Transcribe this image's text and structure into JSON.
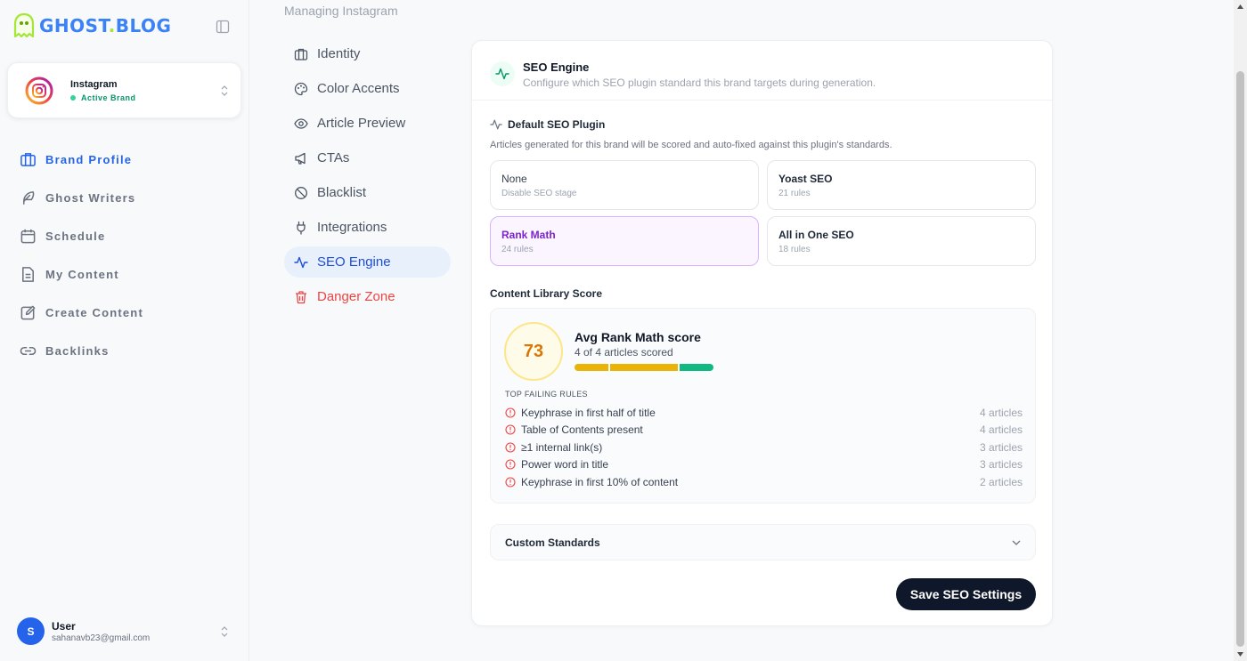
{
  "app": {
    "logo_text": "GHOST",
    "logo_dot": ".",
    "logo_text2": "BLOG"
  },
  "brand": {
    "name": "Instagram",
    "status": "Active Brand"
  },
  "sidebar": {
    "items": [
      {
        "label": "Brand Profile",
        "icon": "briefcase-icon",
        "active": true
      },
      {
        "label": "Ghost Writers",
        "icon": "feather-icon"
      },
      {
        "label": "Schedule",
        "icon": "calendar-icon"
      },
      {
        "label": "My Content",
        "icon": "file-text-icon"
      },
      {
        "label": "Create Content",
        "icon": "edit-icon"
      },
      {
        "label": "Backlinks",
        "icon": "link-icon"
      }
    ]
  },
  "user": {
    "initial": "S",
    "name": "User",
    "email": "sahanavb23@gmail.com"
  },
  "settings": {
    "managing": "Managing Instagram",
    "items": [
      {
        "label": "Identity",
        "icon": "briefcase-icon"
      },
      {
        "label": "Color Accents",
        "icon": "palette-icon"
      },
      {
        "label": "Article Preview",
        "icon": "eye-icon"
      },
      {
        "label": "CTAs",
        "icon": "megaphone-icon"
      },
      {
        "label": "Blacklist",
        "icon": "ban-icon"
      },
      {
        "label": "Integrations",
        "icon": "plug-icon"
      },
      {
        "label": "SEO Engine",
        "icon": "activity-icon",
        "active": true
      },
      {
        "label": "Danger Zone",
        "icon": "trash-icon",
        "danger": true
      }
    ]
  },
  "seo": {
    "title": "SEO Engine",
    "subtitle": "Configure which SEO plugin standard this brand targets during generation.",
    "default_plugin_label": "Default SEO Plugin",
    "default_plugin_desc": "Articles generated for this brand will be scored and auto-fixed against this plugin's standards.",
    "plugins": [
      {
        "name": "None",
        "sub": "Disable SEO stage"
      },
      {
        "name": "Yoast SEO",
        "sub": "21 rules"
      },
      {
        "name": "Rank Math",
        "sub": "24 rules",
        "selected": true
      },
      {
        "name": "All in One SEO",
        "sub": "18 rules"
      }
    ],
    "library_label": "Content Library Score",
    "score": {
      "value": "73",
      "title": "Avg Rank Math score",
      "sub": "4 of 4 articles scored",
      "bar_segments": [
        {
          "share": 0.25,
          "color": "#eab308"
        },
        {
          "share": 0.5,
          "color": "#eab308"
        },
        {
          "share": 0.25,
          "color": "#10b981"
        }
      ]
    },
    "failing_header": "TOP FAILING RULES",
    "failing_rules": [
      {
        "name": "Keyphrase in first half of title",
        "count": "4 articles"
      },
      {
        "name": "Table of Contents present",
        "count": "4 articles"
      },
      {
        "name": "≥1 internal link(s)",
        "count": "3 articles"
      },
      {
        "name": "Power word in title",
        "count": "3 articles"
      },
      {
        "name": "Keyphrase in first 10% of content",
        "count": "2 articles"
      }
    ],
    "custom_standards": "Custom Standards",
    "save_label": "Save SEO Settings"
  },
  "colors": {
    "accent": "#2563eb",
    "danger": "#ef4444",
    "primary_button": "#0f172a",
    "selected_plugin": "#7e22ce"
  }
}
